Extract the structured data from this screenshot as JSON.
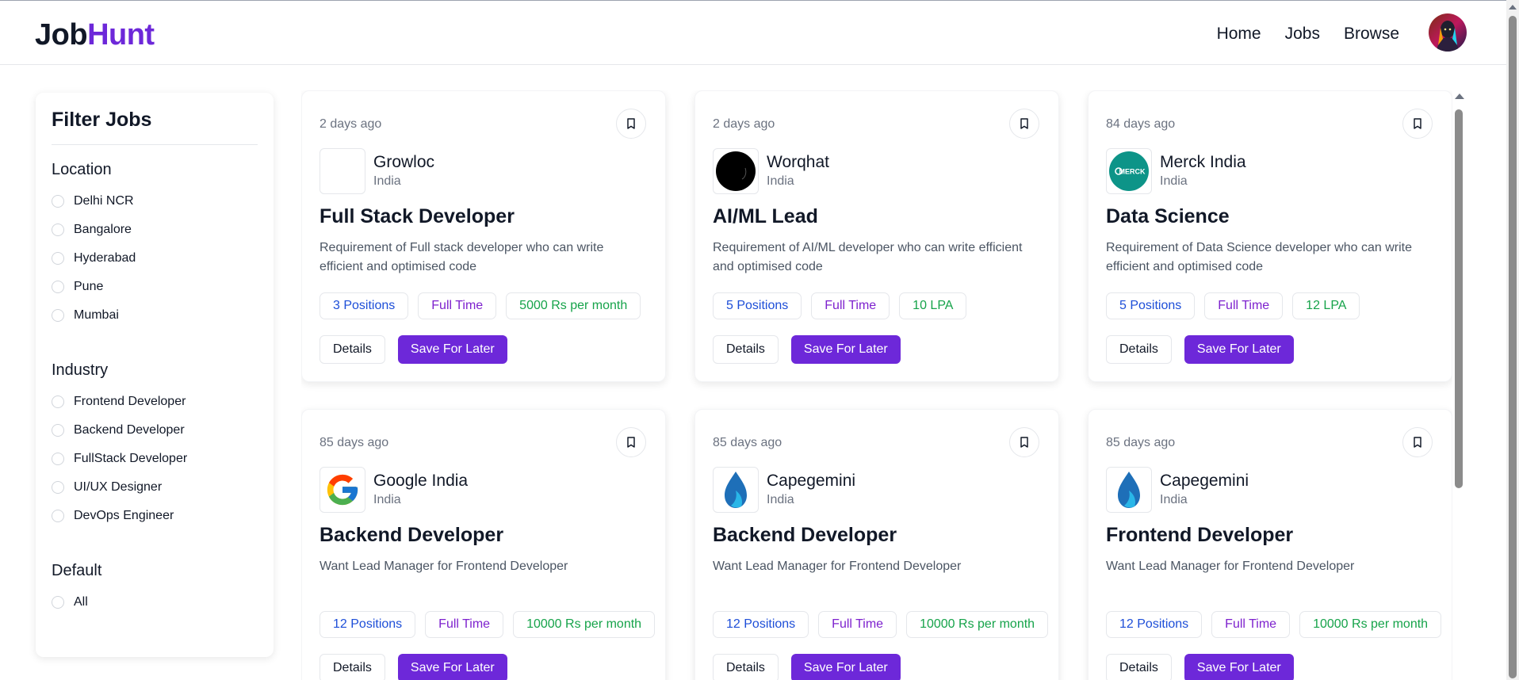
{
  "header": {
    "logo_part1": "Job",
    "logo_part2": "Hunt",
    "nav": [
      "Home",
      "Jobs",
      "Browse"
    ],
    "avatar_icon": "user-avatar"
  },
  "sidebar": {
    "title": "Filter Jobs",
    "groups": [
      {
        "title": "Location",
        "options": [
          "Delhi NCR",
          "Bangalore",
          "Hyderabad",
          "Pune",
          "Mumbai"
        ]
      },
      {
        "title": "Industry",
        "options": [
          "Frontend Developer",
          "Backend Developer",
          "FullStack Developer",
          "UI/UX Designer",
          "DevOps Engineer"
        ]
      },
      {
        "title": "Default",
        "options": [
          "All"
        ]
      }
    ]
  },
  "jobs": [
    {
      "posted": "2 days ago",
      "company": "Growloc",
      "location": "India",
      "logo": "blank-logo",
      "title": "Full Stack Developer",
      "description": "Requirement of Full stack developer who can write efficient and optimised code",
      "positions": "3 Positions",
      "type": "Full Time",
      "salary": "5000 Rs per month",
      "details_label": "Details",
      "save_label": "Save For Later"
    },
    {
      "posted": "2 days ago",
      "company": "Worqhat",
      "location": "India",
      "logo": "worqhat-logo",
      "title": "AI/ML Lead",
      "description": "Requirement of AI/ML developer who can write efficient and optimised code",
      "positions": "5 Positions",
      "type": "Full Time",
      "salary": "10 LPA",
      "details_label": "Details",
      "save_label": "Save For Later"
    },
    {
      "posted": "84 days ago",
      "company": "Merck India",
      "location": "India",
      "logo": "merck-logo",
      "logo_text": "MERCK",
      "title": "Data Science",
      "description": "Requirement of Data Science developer who can write efficient and optimised code",
      "positions": "5 Positions",
      "type": "Full Time",
      "salary": "12 LPA",
      "details_label": "Details",
      "save_label": "Save For Later"
    },
    {
      "posted": "85 days ago",
      "company": "Google India",
      "location": "India",
      "logo": "google-logo",
      "title": "Backend Developer",
      "description": "Want Lead Manager for Frontend Developer",
      "positions": "12 Positions",
      "type": "Full Time",
      "salary": "10000 Rs per month",
      "details_label": "Details",
      "save_label": "Save For Later"
    },
    {
      "posted": "85 days ago",
      "company": "Capegemini",
      "location": "India",
      "logo": "capgemini-logo",
      "title": "Backend Developer",
      "description": "Want Lead Manager for Frontend Developer",
      "positions": "12 Positions",
      "type": "Full Time",
      "salary": "10000 Rs per month",
      "details_label": "Details",
      "save_label": "Save For Later"
    },
    {
      "posted": "85 days ago",
      "company": "Capegemini",
      "location": "India",
      "logo": "capgemini-logo",
      "title": "Frontend Developer",
      "description": "Want Lead Manager for Frontend Developer",
      "positions": "12 Positions",
      "type": "Full Time",
      "salary": "10000 Rs per month",
      "details_label": "Details",
      "save_label": "Save For Later"
    }
  ],
  "colors": {
    "brand": "#6d28d9",
    "blue": "#1d4ed8",
    "purple": "#7e22ce",
    "green": "#16a34a"
  }
}
